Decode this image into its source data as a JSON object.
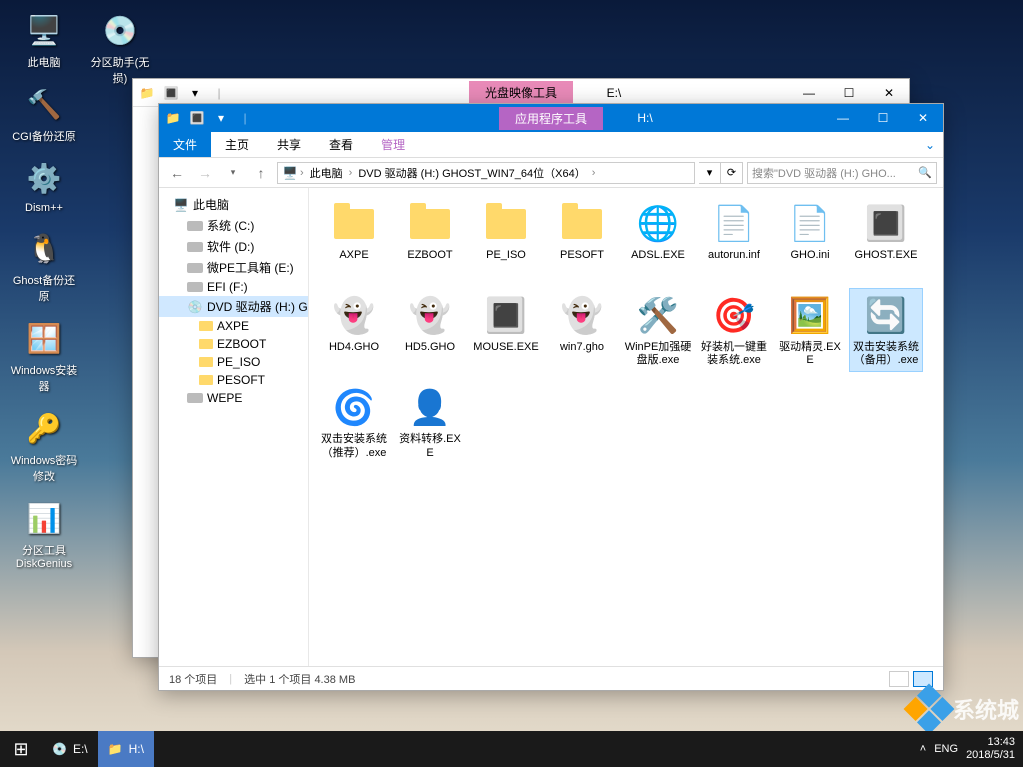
{
  "desktop": {
    "icons": [
      {
        "label": "此电脑",
        "g": "🖥️",
        "color": "#4a90d9"
      },
      {
        "label": "CGI备份还原",
        "g": "🔨",
        "color": "#333"
      },
      {
        "label": "Dism++",
        "g": "⚙️",
        "color": "#4aa0e0"
      },
      {
        "label": "Ghost备份还原",
        "g": "🐧",
        "color": "#ffb400"
      },
      {
        "label": "Windows安装器",
        "g": "🪟",
        "color": "#4a90d9"
      },
      {
        "label": "Windows密码修改",
        "g": "🔑",
        "color": "#ffb400"
      },
      {
        "label": "分区工具DiskGenius",
        "g": "📊",
        "color": "#ff6600"
      }
    ],
    "icons2": [
      {
        "label": "分区助手(无损)",
        "g": "💿"
      }
    ]
  },
  "win_back": {
    "tool_tab": "光盘映像工具",
    "drive_label": "E:\\"
  },
  "win_front": {
    "tool_tab": "应用程序工具",
    "drive_label": "H:\\",
    "ribbon": {
      "file": "文件",
      "home": "主页",
      "share": "共享",
      "view": "查看",
      "manage": "管理"
    },
    "breadcrumb": [
      "此电脑",
      "DVD 驱动器 (H:) GHOST_WIN7_64位（X64）"
    ],
    "search_placeholder": "搜索\"DVD 驱动器 (H:) GHO...",
    "nav": [
      {
        "label": "此电脑",
        "ico": "🖥️",
        "lvl": 0
      },
      {
        "label": "系统 (C:)",
        "ico": "disk",
        "lvl": 1
      },
      {
        "label": "软件 (D:)",
        "ico": "disk",
        "lvl": 1
      },
      {
        "label": "微PE工具箱 (E:)",
        "ico": "disk",
        "lvl": 1
      },
      {
        "label": "EFI (F:)",
        "ico": "disk",
        "lvl": 1
      },
      {
        "label": "DVD 驱动器 (H:) G",
        "ico": "💿",
        "lvl": 1,
        "sel": true
      },
      {
        "label": "AXPE",
        "ico": "fold",
        "lvl": 2
      },
      {
        "label": "EZBOOT",
        "ico": "fold",
        "lvl": 2
      },
      {
        "label": "PE_ISO",
        "ico": "fold",
        "lvl": 2
      },
      {
        "label": "PESOFT",
        "ico": "fold",
        "lvl": 2
      },
      {
        "label": "WEPE",
        "ico": "disk",
        "lvl": 1
      }
    ],
    "files": [
      {
        "label": "AXPE",
        "type": "folder"
      },
      {
        "label": "EZBOOT",
        "type": "folder"
      },
      {
        "label": "PE_ISO",
        "type": "folder"
      },
      {
        "label": "PESOFT",
        "type": "folder"
      },
      {
        "label": "ADSL.EXE",
        "type": "exe",
        "g": "🌐"
      },
      {
        "label": "autorun.inf",
        "type": "file",
        "g": "📄"
      },
      {
        "label": "GHO.ini",
        "type": "file",
        "g": "📄"
      },
      {
        "label": "GHOST.EXE",
        "type": "exe",
        "g": "🔳"
      },
      {
        "label": "HD4.GHO",
        "type": "gho",
        "g": "👻"
      },
      {
        "label": "HD5.GHO",
        "type": "gho",
        "g": "👻"
      },
      {
        "label": "MOUSE.EXE",
        "type": "exe",
        "g": "🔳"
      },
      {
        "label": "win7.gho",
        "type": "gho",
        "g": "👻"
      },
      {
        "label": "WinPE加强硬盘版.exe",
        "type": "exe",
        "g": "🛠️"
      },
      {
        "label": "好装机一键重装系统.exe",
        "type": "exe",
        "g": "🎯"
      },
      {
        "label": "驱动精灵.EXE",
        "type": "exe",
        "g": "🖼️"
      },
      {
        "label": "双击安装系统（备用）.exe",
        "type": "exe",
        "g": "🔄",
        "sel": true
      },
      {
        "label": "双击安装系统（推荐）.exe",
        "type": "exe",
        "g": "🌀"
      },
      {
        "label": "资料转移.EXE",
        "type": "exe",
        "g": "👤"
      }
    ],
    "status": {
      "count": "18 个项目",
      "selected": "选中 1 个项目  4.38 MB"
    }
  },
  "taskbar": {
    "items": [
      {
        "label": "E:\\",
        "g": "💿"
      },
      {
        "label": "H:\\",
        "g": "📁",
        "active": true
      }
    ],
    "lang": "ENG",
    "time": "13:43",
    "date": "2018/5/31",
    "watermark": "系统城"
  }
}
